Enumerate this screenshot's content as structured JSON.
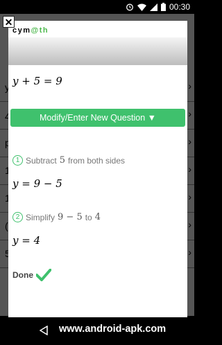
{
  "status_bar": {
    "time": "00:30"
  },
  "background": {
    "row_chars": [
      "y",
      "4",
      "p",
      "1",
      "1",
      "(",
      "5"
    ]
  },
  "modal": {
    "logo_part1": "cym",
    "logo_part2": "@th",
    "equation": "y + 5 = 9",
    "modify_button": "Modify/Enter New Question ▼",
    "steps": [
      {
        "number": "1",
        "text_before": "Subtract",
        "math": "5",
        "text_after": "from both sides",
        "result": "y = 9 − 5"
      },
      {
        "number": "2",
        "text_before": "Simplify",
        "math": "9 − 5",
        "text_after": "to",
        "math2": "4",
        "result": "y = 4"
      }
    ],
    "done_label": "Done"
  },
  "watermark": "www.android-apk.com",
  "colors": {
    "accent_green": "#3fc16d"
  }
}
